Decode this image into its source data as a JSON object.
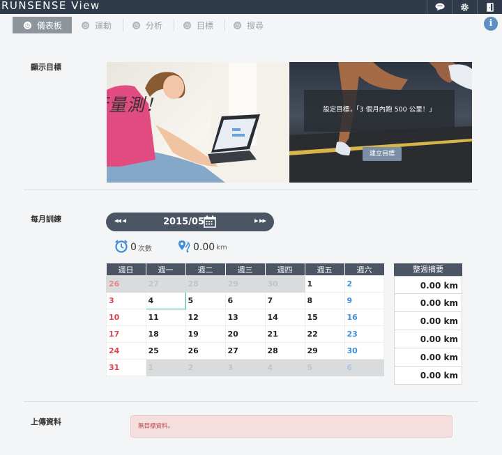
{
  "app": {
    "brand": "RUNSENSE View"
  },
  "topbar": {
    "icons": [
      "chat-icon",
      "gear-icon",
      "door-exit-icon"
    ]
  },
  "tabs": [
    {
      "label": "儀表板",
      "active": true
    },
    {
      "label": "運動",
      "active": false
    },
    {
      "label": "分析",
      "active": false
    },
    {
      "label": "目標",
      "active": false
    },
    {
      "label": "搜尋",
      "active": false
    }
  ],
  "info_label": "i",
  "goal_section": {
    "label": "顯示目標",
    "measure_text": "請自行量測！",
    "goal_text": "設定目標，「3 個月內跑 500 公里！」",
    "goal_button": "建立目標"
  },
  "monthly": {
    "label": "每月訓練",
    "month": "2015/05",
    "prev_label": "◂◂ ◂",
    "next_label": "▸ ▸▸",
    "count_value": "0",
    "count_unit": "次數",
    "distance_value": "0.00",
    "distance_unit": "km"
  },
  "calendar": {
    "weekdays": [
      "週日",
      "週一",
      "週二",
      "週三",
      "週四",
      "週五",
      "週六"
    ],
    "weeks": [
      [
        "26",
        "27",
        "28",
        "29",
        "30",
        "1",
        "2"
      ],
      [
        "3",
        "4",
        "5",
        "6",
        "7",
        "8",
        "9"
      ],
      [
        "10",
        "11",
        "12",
        "13",
        "14",
        "15",
        "16"
      ],
      [
        "17",
        "18",
        "19",
        "20",
        "21",
        "22",
        "23"
      ],
      [
        "24",
        "25",
        "26",
        "27",
        "28",
        "29",
        "30"
      ],
      [
        "31",
        "1",
        "2",
        "3",
        "4",
        "5",
        "6"
      ]
    ]
  },
  "weekly_summary": {
    "title": "整週摘要",
    "rows": [
      "0.00 km",
      "0.00 km",
      "0.00 km",
      "0.00 km",
      "0.00 km",
      "0.00 km"
    ]
  },
  "upload": {
    "label": "上傳資料",
    "message": "無目標資料。"
  },
  "colors": {
    "topbar": "#2f3b4a",
    "accent_bar": "#4b5563",
    "sunday": "#e2434c",
    "saturday": "#3d8edb"
  }
}
